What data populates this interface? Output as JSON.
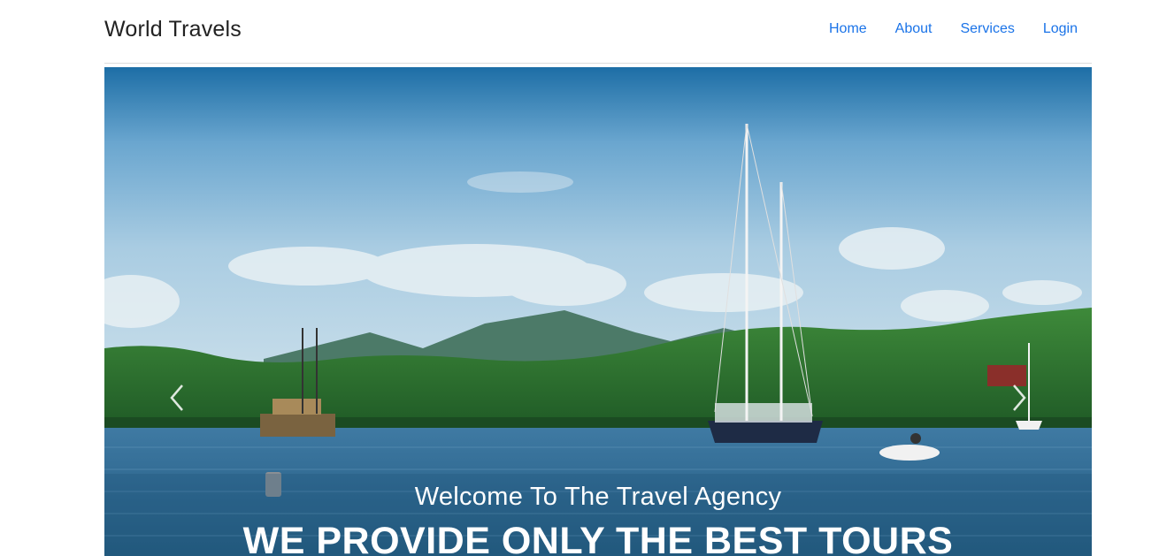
{
  "navbar": {
    "brand": "World Travels",
    "links": [
      "Home",
      "About",
      "Services",
      "Login"
    ],
    "link_color": "#1a73e8"
  },
  "hero": {
    "subtitle": "Welcome To The Travel Agency",
    "title": "WE PROVIDE ONLY THE BEST TOURS",
    "prev_icon": "chevron-left-icon",
    "next_icon": "chevron-right-icon"
  }
}
